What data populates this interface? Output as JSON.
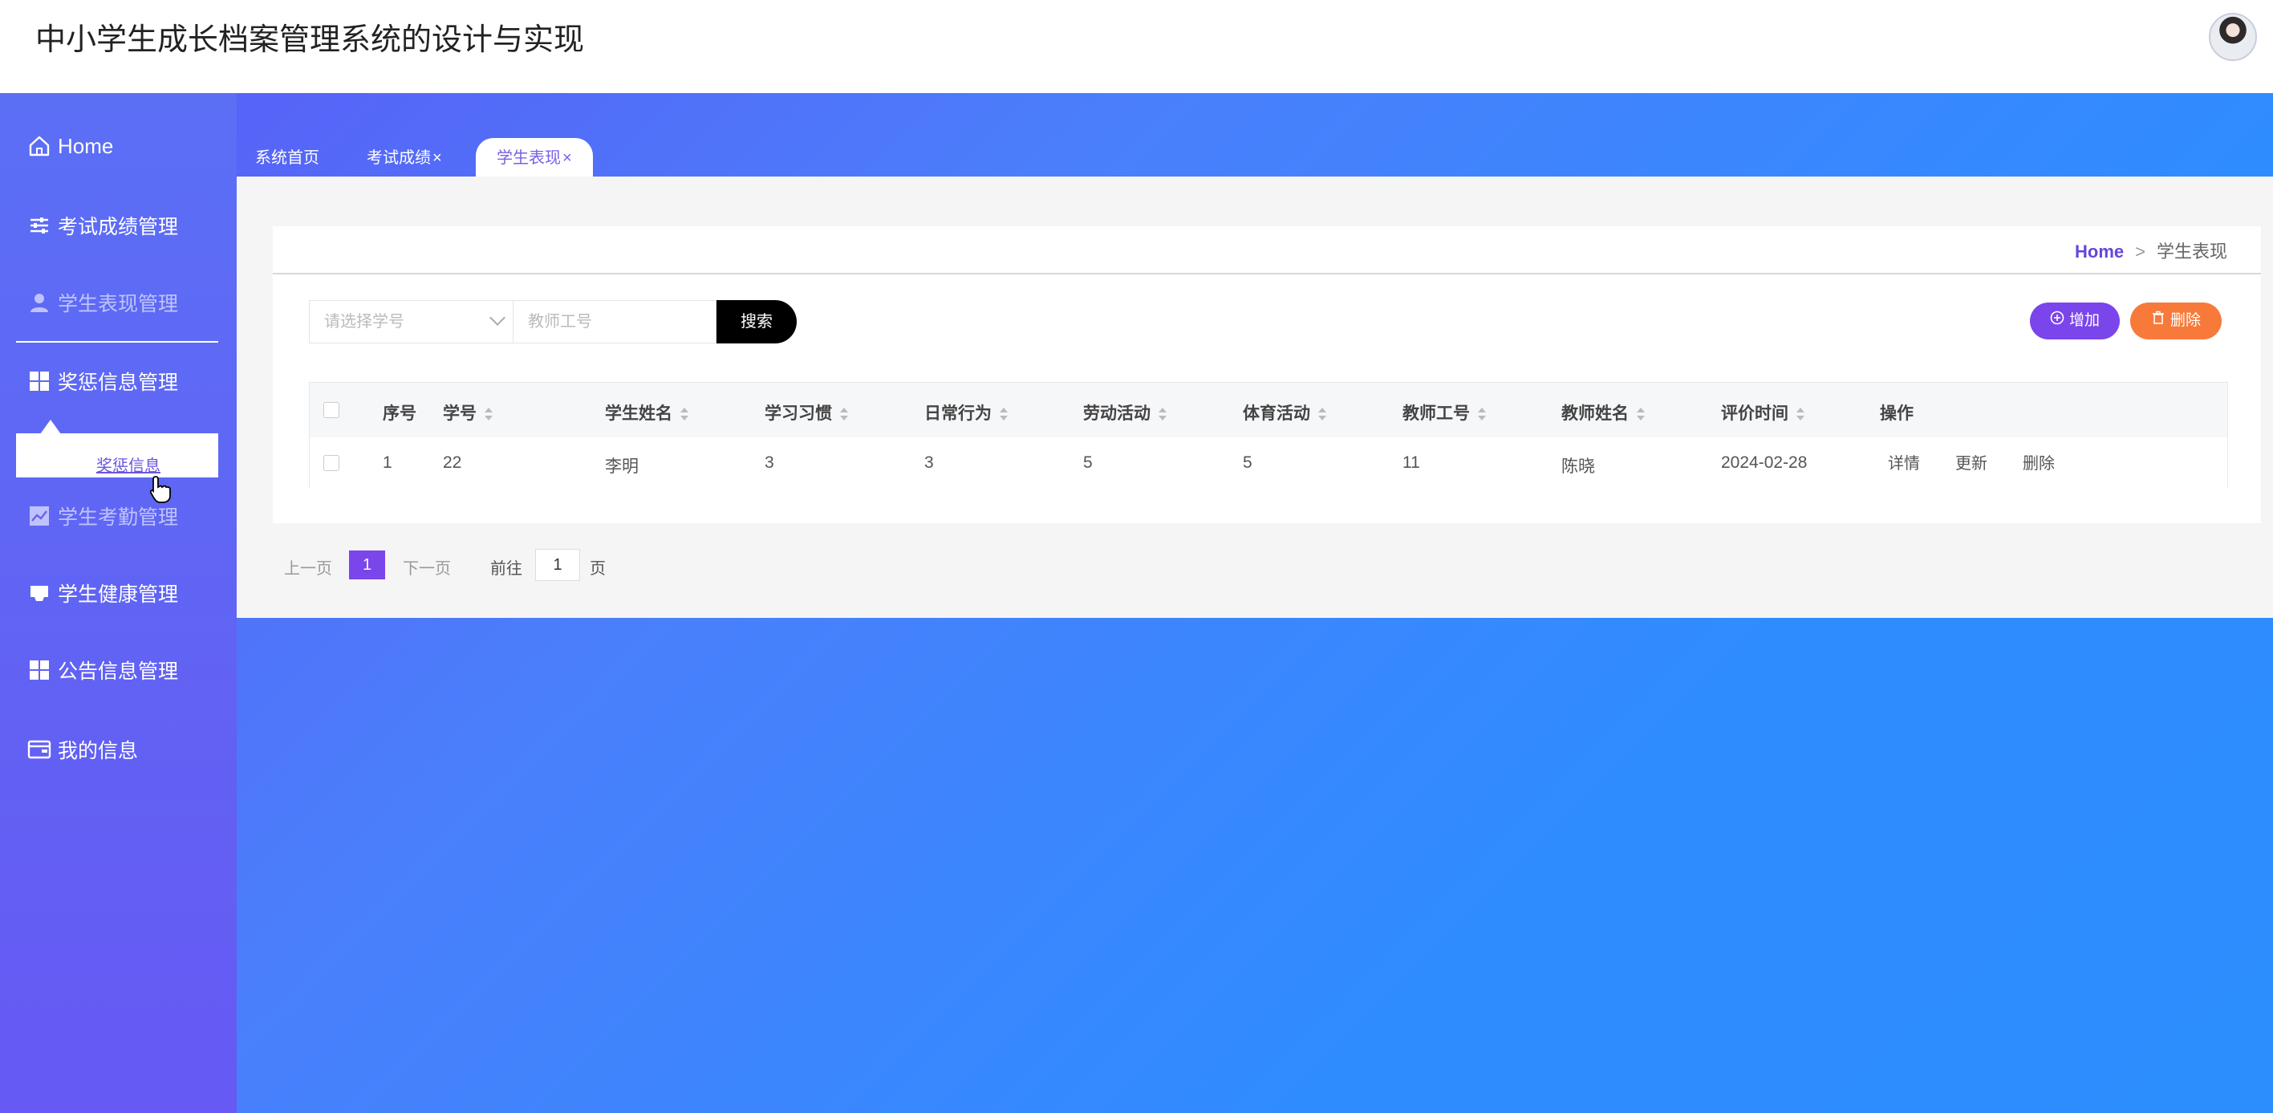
{
  "header": {
    "title": "中小学生成长档案管理系统的设计与实现"
  },
  "sidebar": {
    "items": [
      {
        "label": "Home",
        "icon": "home-icon"
      },
      {
        "label": "考试成绩管理",
        "icon": "sliders-icon"
      },
      {
        "label": "学生表现管理",
        "icon": "user-icon"
      },
      {
        "label": "奖惩信息管理",
        "icon": "grid-icon"
      },
      {
        "label": "学生考勤管理",
        "icon": "chart-icon"
      },
      {
        "label": "学生健康管理",
        "icon": "box-icon"
      },
      {
        "label": "公告信息管理",
        "icon": "grid-icon"
      },
      {
        "label": "我的信息",
        "icon": "wallet-icon"
      }
    ],
    "submenu": {
      "label": "奖惩信息"
    }
  },
  "tabs": [
    {
      "label": "系统首页",
      "closable": false
    },
    {
      "label": "考试成绩",
      "closable": true
    },
    {
      "label": "学生表现",
      "closable": true,
      "active": true
    }
  ],
  "tab_close_glyph": "×",
  "breadcrumb": {
    "home": "Home",
    "separator": ">",
    "current": "学生表现"
  },
  "search": {
    "select_placeholder": "请选择学号",
    "input_placeholder": "教师工号",
    "button": "搜索"
  },
  "actions": {
    "add": "增加",
    "delete": "删除"
  },
  "table": {
    "headers": [
      "序号",
      "学号",
      "学生姓名",
      "学习习惯",
      "日常行为",
      "劳动活动",
      "体育活动",
      "教师工号",
      "教师姓名",
      "评价时间",
      "操作"
    ],
    "rows": [
      {
        "cells": [
          "1",
          "22",
          "李明",
          "3",
          "3",
          "5",
          "5",
          "11",
          "陈晓",
          "2024-02-28"
        ],
        "ops": [
          "详情",
          "更新",
          "删除"
        ]
      }
    ]
  },
  "pagination": {
    "prev": "上一页",
    "current": "1",
    "next": "下一页",
    "goto": "前往",
    "goto_value": "1",
    "page_unit": "页"
  },
  "colors": {
    "accent": "#7b45ec",
    "danger": "#f77a3a",
    "sidebar": "#5f66f5",
    "link": "#6b55e0"
  }
}
